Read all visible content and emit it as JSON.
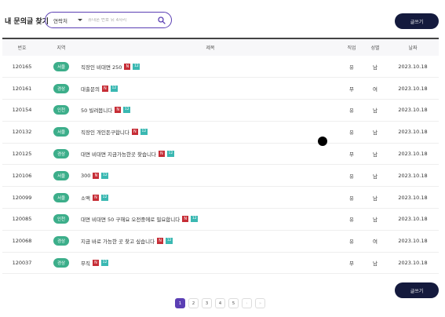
{
  "header": {
    "title": "내 문의글 찾기",
    "search_select": "연락처",
    "search_placeholder": "휴대폰 번호 뒤 4자리",
    "write_label": "글쓰기"
  },
  "table": {
    "columns": [
      "번호",
      "지역",
      "제목",
      "직업",
      "성별",
      "날짜"
    ],
    "rows": [
      {
        "no": "120165",
        "region": "서울",
        "title": "직장인 비대면 250",
        "job": "유",
        "gender": "남",
        "date": "2023.10.18"
      },
      {
        "no": "120161",
        "region": "경상",
        "title": "대출문의",
        "job": "무",
        "gender": "여",
        "date": "2023.10.18"
      },
      {
        "no": "120154",
        "region": "인천",
        "title": "50 빌려봅니다",
        "job": "유",
        "gender": "남",
        "date": "2023.10.18"
      },
      {
        "no": "120132",
        "region": "서울",
        "title": "직장인 개인돈구합니다",
        "job": "유",
        "gender": "남",
        "date": "2023.10.18"
      },
      {
        "no": "120125",
        "region": "경상",
        "title": "대면 비대면 지금가능한곳 찾습니다",
        "job": "무",
        "gender": "남",
        "date": "2023.10.18"
      },
      {
        "no": "120106",
        "region": "서울",
        "title": "300",
        "job": "유",
        "gender": "남",
        "date": "2023.10.18"
      },
      {
        "no": "120099",
        "region": "서울",
        "title": "소액",
        "job": "유",
        "gender": "남",
        "date": "2023.10.18"
      },
      {
        "no": "120085",
        "region": "인천",
        "title": "대면 비대면 50 구해요 오전중에로 필요합니다",
        "job": "유",
        "gender": "남",
        "date": "2023.10.18"
      },
      {
        "no": "120068",
        "region": "경상",
        "title": "지금 바로 가능한 곳 찾고 싶습니다",
        "job": "유",
        "gender": "여",
        "date": "2023.10.18"
      },
      {
        "no": "120037",
        "region": "경상",
        "title": "무직",
        "job": "무",
        "gender": "남",
        "date": "2023.10.18"
      }
    ],
    "badge_new": "N",
    "badge_count": "12"
  },
  "colors": {
    "서울": "#3cae8a",
    "경상": "#3cae8a",
    "인천": "#3cae8a",
    "accent": "#5b3fb4",
    "button": "#141a3d"
  },
  "pagination": {
    "pages": [
      "1",
      "2",
      "3",
      "4",
      "5"
    ],
    "active": "1",
    "next": "›",
    "last": "»"
  }
}
